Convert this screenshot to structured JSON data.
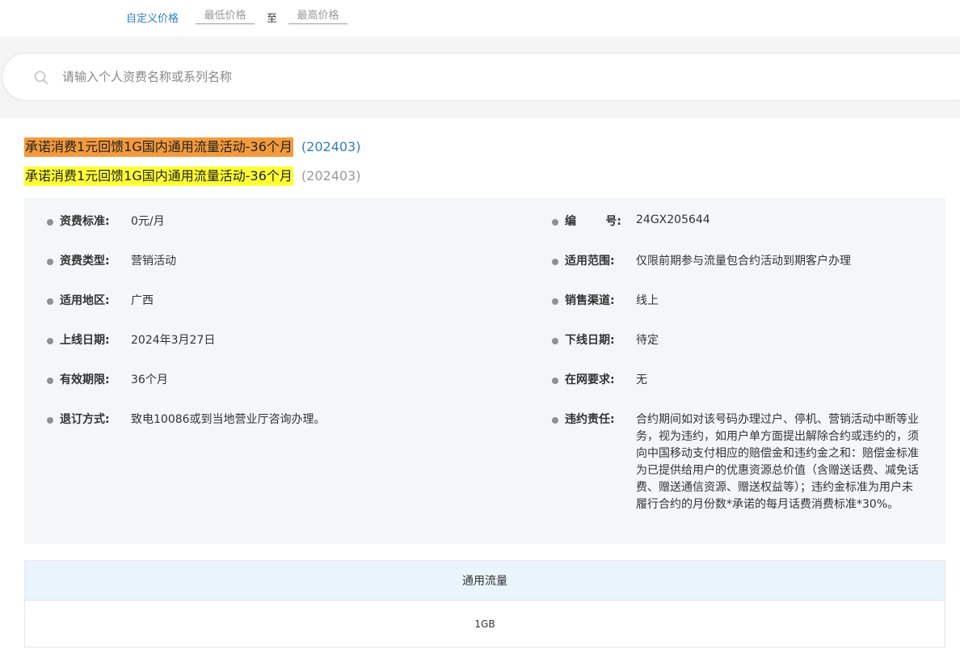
{
  "price_filter": {
    "label": "自定义价格",
    "min_placeholder": "最低价格",
    "separator": "至",
    "max_placeholder": "最高价格"
  },
  "search": {
    "placeholder": "请输入个人资费名称或系列名称",
    "icon": "search-icon"
  },
  "titles": [
    {
      "text": "承诺消费1元回馈1G国内通用流量活动-36个月",
      "code": "(202403)",
      "highlight": "#f39a3c",
      "code_color": "#2f7fc1"
    },
    {
      "text": "承诺消费1元回馈1G国内通用流量活动-36个月",
      "code": "(202403)",
      "highlight": "#ffff33",
      "code_color": "#999999"
    }
  ],
  "details": {
    "left": [
      {
        "label": "资费标准:",
        "value": "0元/月"
      },
      {
        "label": "资费类型:",
        "value": "营销活动"
      },
      {
        "label": "适用地区:",
        "value": "广西"
      },
      {
        "label": "上线日期:",
        "value": "2024年3月27日"
      },
      {
        "label": "有效期限:",
        "value": "36个月"
      },
      {
        "label": "退订方式:",
        "value": "致电10086或到当地营业厅咨询办理。"
      }
    ],
    "right": [
      {
        "label_a": "编",
        "label_b": "号:",
        "value": "24GX205644"
      },
      {
        "label": "适用范围:",
        "value": "仅限前期参与流量包合约活动到期客户办理"
      },
      {
        "label": "销售渠道:",
        "value": "线上"
      },
      {
        "label": "下线日期:",
        "value": "待定"
      },
      {
        "label": "在网要求:",
        "value": "无"
      },
      {
        "label": "违约责任:",
        "value": "合约期间如对该号码办理过户、停机、营销活动中断等业务，视为违约，如用户单方面提出解除合约或违约的，须向中国移动支付相应的赔偿金和违约金之和：赔偿金标准为已提供给用户的优惠资源总价值（含赠送话费、减免话费、赠送通信资源、赠送权益等）；违约金标准为用户未履行合约的月份数*承诺的每月话费消费标准*30%。"
      }
    ]
  },
  "table": {
    "header": "通用流量",
    "value": "1GB"
  }
}
